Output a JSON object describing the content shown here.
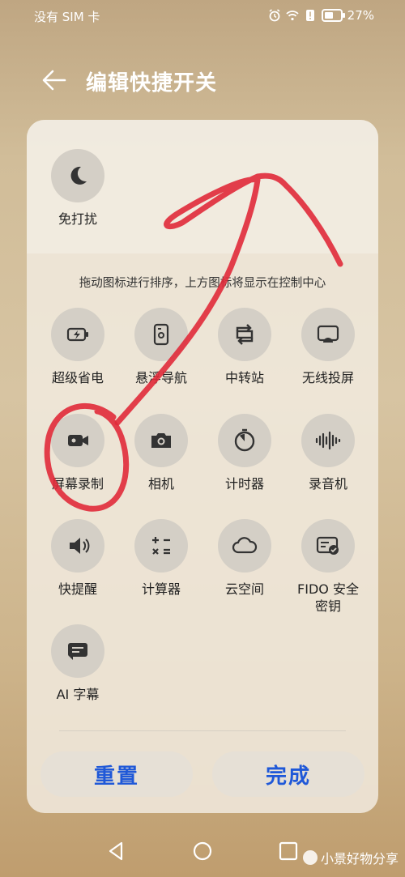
{
  "status": {
    "carrier": "没有 SIM 卡",
    "battery": "27%"
  },
  "header": {
    "title": "编辑快捷开关"
  },
  "top_section": {
    "tiles": [
      {
        "label": "免打扰",
        "icon": "moon-icon"
      }
    ]
  },
  "hint": "拖动图标进行排序，上方图标将显示在控制中心",
  "tiles": [
    {
      "label": "超级省电",
      "icon": "battery-bolt-icon"
    },
    {
      "label": "悬浮导航",
      "icon": "floating-nav-icon"
    },
    {
      "label": "中转站",
      "icon": "transfer-icon"
    },
    {
      "label": "无线投屏",
      "icon": "cast-icon"
    },
    {
      "label": "屏幕录制",
      "icon": "screen-record-icon"
    },
    {
      "label": "相机",
      "icon": "camera-icon"
    },
    {
      "label": "计时器",
      "icon": "timer-icon"
    },
    {
      "label": "录音机",
      "icon": "recorder-icon"
    },
    {
      "label": "快提醒",
      "icon": "reminder-icon"
    },
    {
      "label": "计算器",
      "icon": "calculator-icon"
    },
    {
      "label": "云空间",
      "icon": "cloud-icon"
    },
    {
      "label": "FIDO 安全\n密钥",
      "icon": "security-key-icon"
    },
    {
      "label": "AI 字幕",
      "icon": "subtitle-icon"
    }
  ],
  "buttons": {
    "reset": "重置",
    "done": "完成"
  },
  "watermark": "小景好物分享",
  "colors": {
    "accent": "#1f58d8",
    "annotation": "#e02a3a"
  }
}
